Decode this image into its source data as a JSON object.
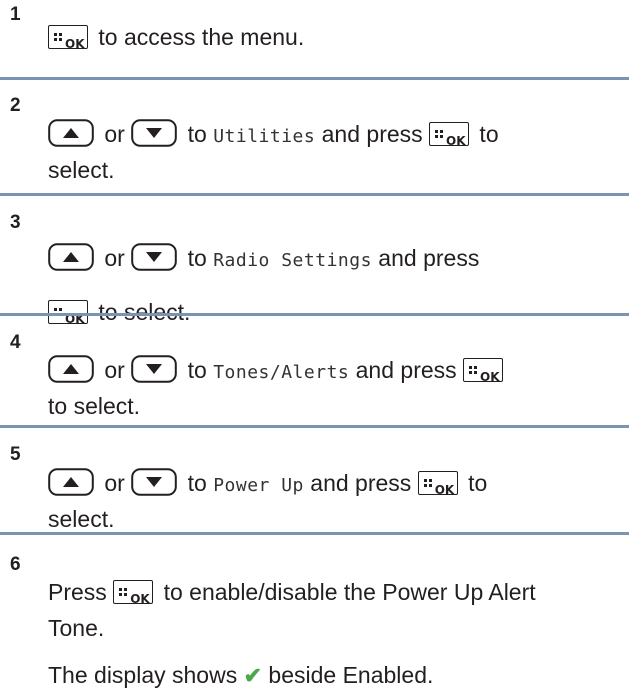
{
  "steps": [
    {
      "number": "1",
      "lines": [
        [
          {
            "k": "ok"
          },
          {
            "t": " to access the menu."
          }
        ]
      ]
    },
    {
      "number": "2",
      "lines": [
        [
          {
            "k": "up"
          },
          {
            "t": " or "
          },
          {
            "k": "down"
          },
          {
            "t": " to "
          },
          {
            "m": "Utilities"
          },
          {
            "t": " and press "
          },
          {
            "k": "ok"
          },
          {
            "t": " to"
          }
        ],
        [
          {
            "t": "select."
          }
        ]
      ]
    },
    {
      "number": "3",
      "lines": [
        [
          {
            "k": "up"
          },
          {
            "t": " or "
          },
          {
            "k": "down"
          },
          {
            "t": " to "
          },
          {
            "m": "Radio Settings"
          },
          {
            "t": " and press"
          }
        ],
        [
          {
            "k": "ok"
          },
          {
            "t": " to select."
          }
        ]
      ]
    },
    {
      "number": "4",
      "lines": [
        [
          {
            "k": "up"
          },
          {
            "t": " or "
          },
          {
            "k": "down"
          },
          {
            "t": " to "
          },
          {
            "m": "Tones/Alerts"
          },
          {
            "t": " and press "
          },
          {
            "k": "ok"
          }
        ],
        [
          {
            "t": "to select."
          }
        ]
      ]
    },
    {
      "number": "5",
      "lines": [
        [
          {
            "k": "up"
          },
          {
            "t": " or "
          },
          {
            "k": "down"
          },
          {
            "t": " to "
          },
          {
            "m": "Power Up"
          },
          {
            "t": " and press "
          },
          {
            "k": "ok"
          },
          {
            "t": " to"
          }
        ],
        [
          {
            "t": "select."
          }
        ]
      ]
    },
    {
      "number": "6",
      "lines": [
        [
          {
            "t": "Press "
          },
          {
            "k": "ok"
          },
          {
            "t": " to enable/disable the Power Up Alert"
          }
        ],
        [
          {
            "t": "Tone."
          }
        ],
        [
          {
            "t": "The display shows "
          },
          {
            "c": "✔"
          },
          {
            "t": " beside Enabled."
          }
        ]
      ]
    }
  ],
  "icons": {
    "ok": "menu-ok-key-icon",
    "up": "up-arrow-key-icon",
    "down": "down-arrow-key-icon",
    "check": "checkmark-icon"
  },
  "ok_key_label": "OK",
  "colors": {
    "divider": "#7a93b0",
    "check": "#4aa84a",
    "text": "#231f20"
  }
}
